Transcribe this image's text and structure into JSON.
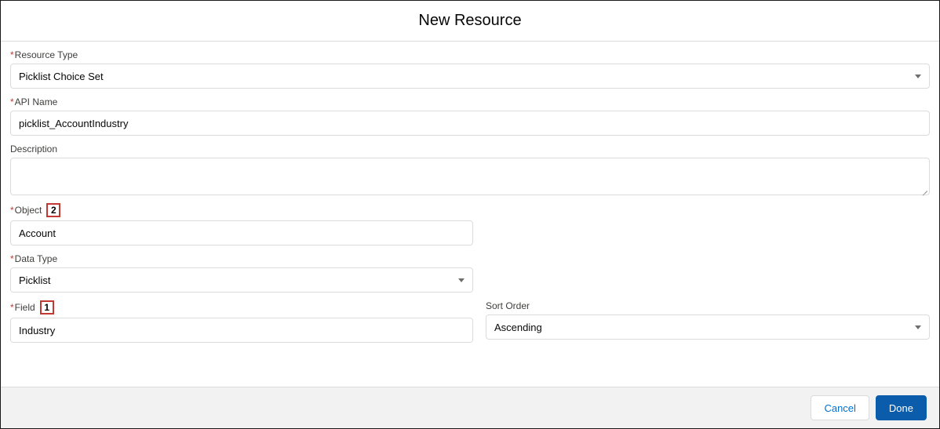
{
  "modal": {
    "title": "New Resource"
  },
  "resourceType": {
    "label": "Resource Type",
    "value": "Picklist Choice Set"
  },
  "apiName": {
    "label": "API Name",
    "value": "picklist_AccountIndustry"
  },
  "description": {
    "label": "Description",
    "value": ""
  },
  "object": {
    "label": "Object",
    "value": "Account",
    "callout": "2"
  },
  "dataType": {
    "label": "Data Type",
    "value": "Picklist"
  },
  "field": {
    "label": "Field",
    "value": "Industry",
    "callout": "1"
  },
  "sortOrder": {
    "label": "Sort Order",
    "value": "Ascending"
  },
  "footer": {
    "cancel": "Cancel",
    "done": "Done"
  }
}
